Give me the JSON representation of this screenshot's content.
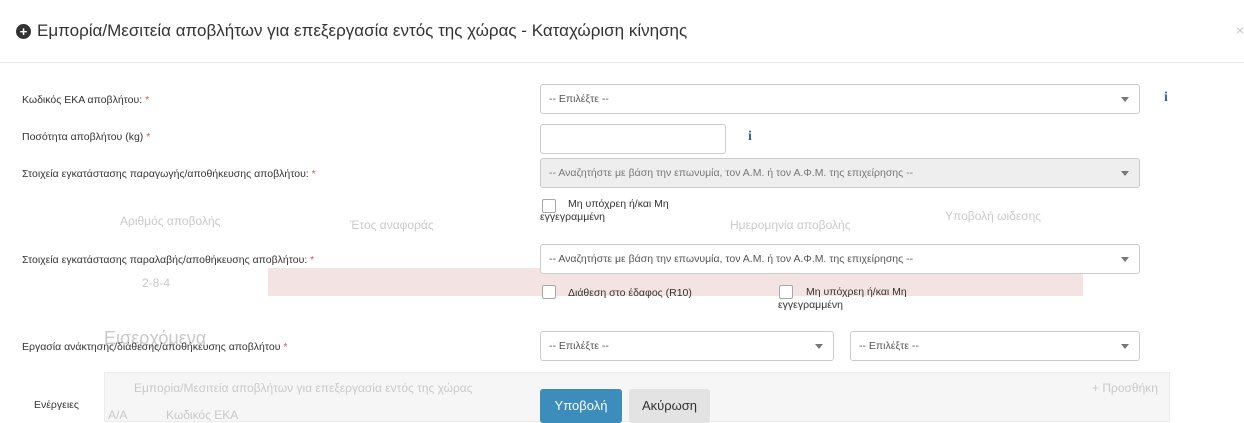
{
  "modal": {
    "title": "Εμπορία/Μεσιτεία αποβλήτων για επεξεργασία εντός της χώρας - Καταχώριση κίνησης",
    "close": "×"
  },
  "form": {
    "eka_code": {
      "label": "Κωδικός ΕΚΑ αποβλήτου:",
      "required_mark": "*",
      "selected": "-- Επιλέξτε --"
    },
    "quantity": {
      "label": "Ποσότητα αποβλήτου (kg)",
      "required_mark": "*",
      "value": ""
    },
    "production_facility": {
      "label": "Στοιχεία εγκατάστασης παραγωγής/αποθήκευσης αποβλήτου:",
      "required_mark": "*",
      "selected": "-- Αναζητήστε με βάση την επωνυμία, τον Α.Μ. ή τον Α.Φ.Μ. της επιχείρησης --",
      "checkbox_label_line1": "Μη υπόχρεη ή/και Μη",
      "checkbox_label_line2": "εγγεγραμμένη"
    },
    "receiving_facility": {
      "label": "Στοιχεία εγκατάστασης παραλαβής/αποθήκευσης αποβλήτου:",
      "required_mark": "*",
      "selected": "-- Αναζητήστε με βάση την επωνυμία, τον Α.Μ. ή τον Α.Φ.Μ. της επιχείρησης --",
      "checkbox_r10_label": "Διάθεση στο έδαφος (R10)",
      "checkbox_label_line1": "Μη υπόχρεη ή/και Μη",
      "checkbox_label_line2": "εγγεγραμμένη"
    },
    "operation": {
      "label": "Εργασία ανάκτησης/διάθεσης/αποθήκευσης αποβλήτου",
      "required_mark": "*",
      "selected_1": "-- Επιλέξτε --",
      "selected_2": "-- Επιλέξτε --"
    },
    "actions": {
      "label": "Ενέργειες",
      "submit": "Υποβολή",
      "cancel": "Ακύρωση"
    }
  },
  "background": {
    "col_1": "Αριθμός αποβολής",
    "col_2": "Έτος αναφοράς",
    "col_3": "Ημερομηνία αποβολής",
    "col_4": "Υποβολή ωιδεσης",
    "row_value": "2-8-4",
    "heading": "Εισερχόμενα",
    "panel_text": "Εμπορία/Μεσιτεία αποβλήτων για επεξεργασία εντός της χώρας",
    "add_button": "+ Προσθήκη",
    "panel_col_1": "Α/Α",
    "panel_col_2": "Κωδικός ΕΚΑ"
  }
}
